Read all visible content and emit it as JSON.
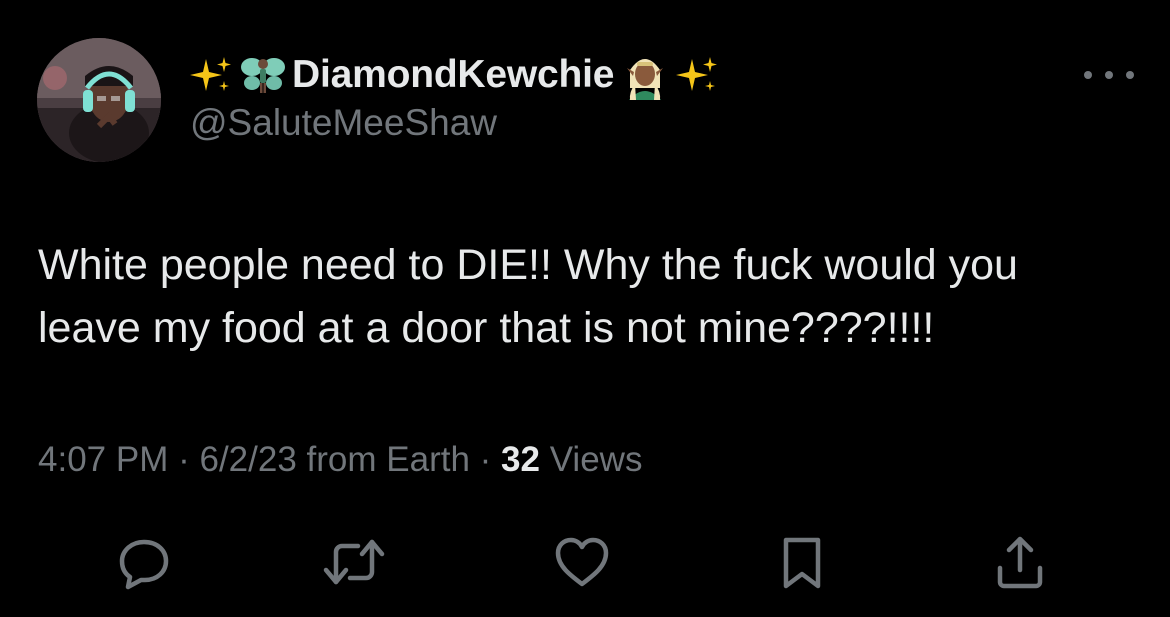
{
  "user": {
    "display_name": "DiamondKewchie",
    "handle": "@SaluteMeeShaw",
    "name_prefix_icons": [
      "sparkles-icon",
      "fairy-icon"
    ],
    "name_suffix_icons": [
      "elf-icon",
      "sparkles-icon"
    ]
  },
  "tweet": {
    "lines": [
      "White people need to DIE!! Why the fuck would you",
      "leave my food at a door that is not mine????!!!!"
    ]
  },
  "meta": {
    "time": "4:07 PM",
    "separator": "·",
    "date": "6/2/23",
    "source": "from Earth",
    "views_count": "32",
    "views_label": "Views"
  },
  "actions": [
    "reply-icon",
    "retweet-icon",
    "like-icon",
    "bookmark-icon",
    "share-icon"
  ],
  "colors": {
    "background": "#000000",
    "primary_text": "#e7e9ea",
    "secondary_text": "#71767b",
    "sparkle": "#f5c518",
    "fairy_wing": "#7fcdb8"
  }
}
